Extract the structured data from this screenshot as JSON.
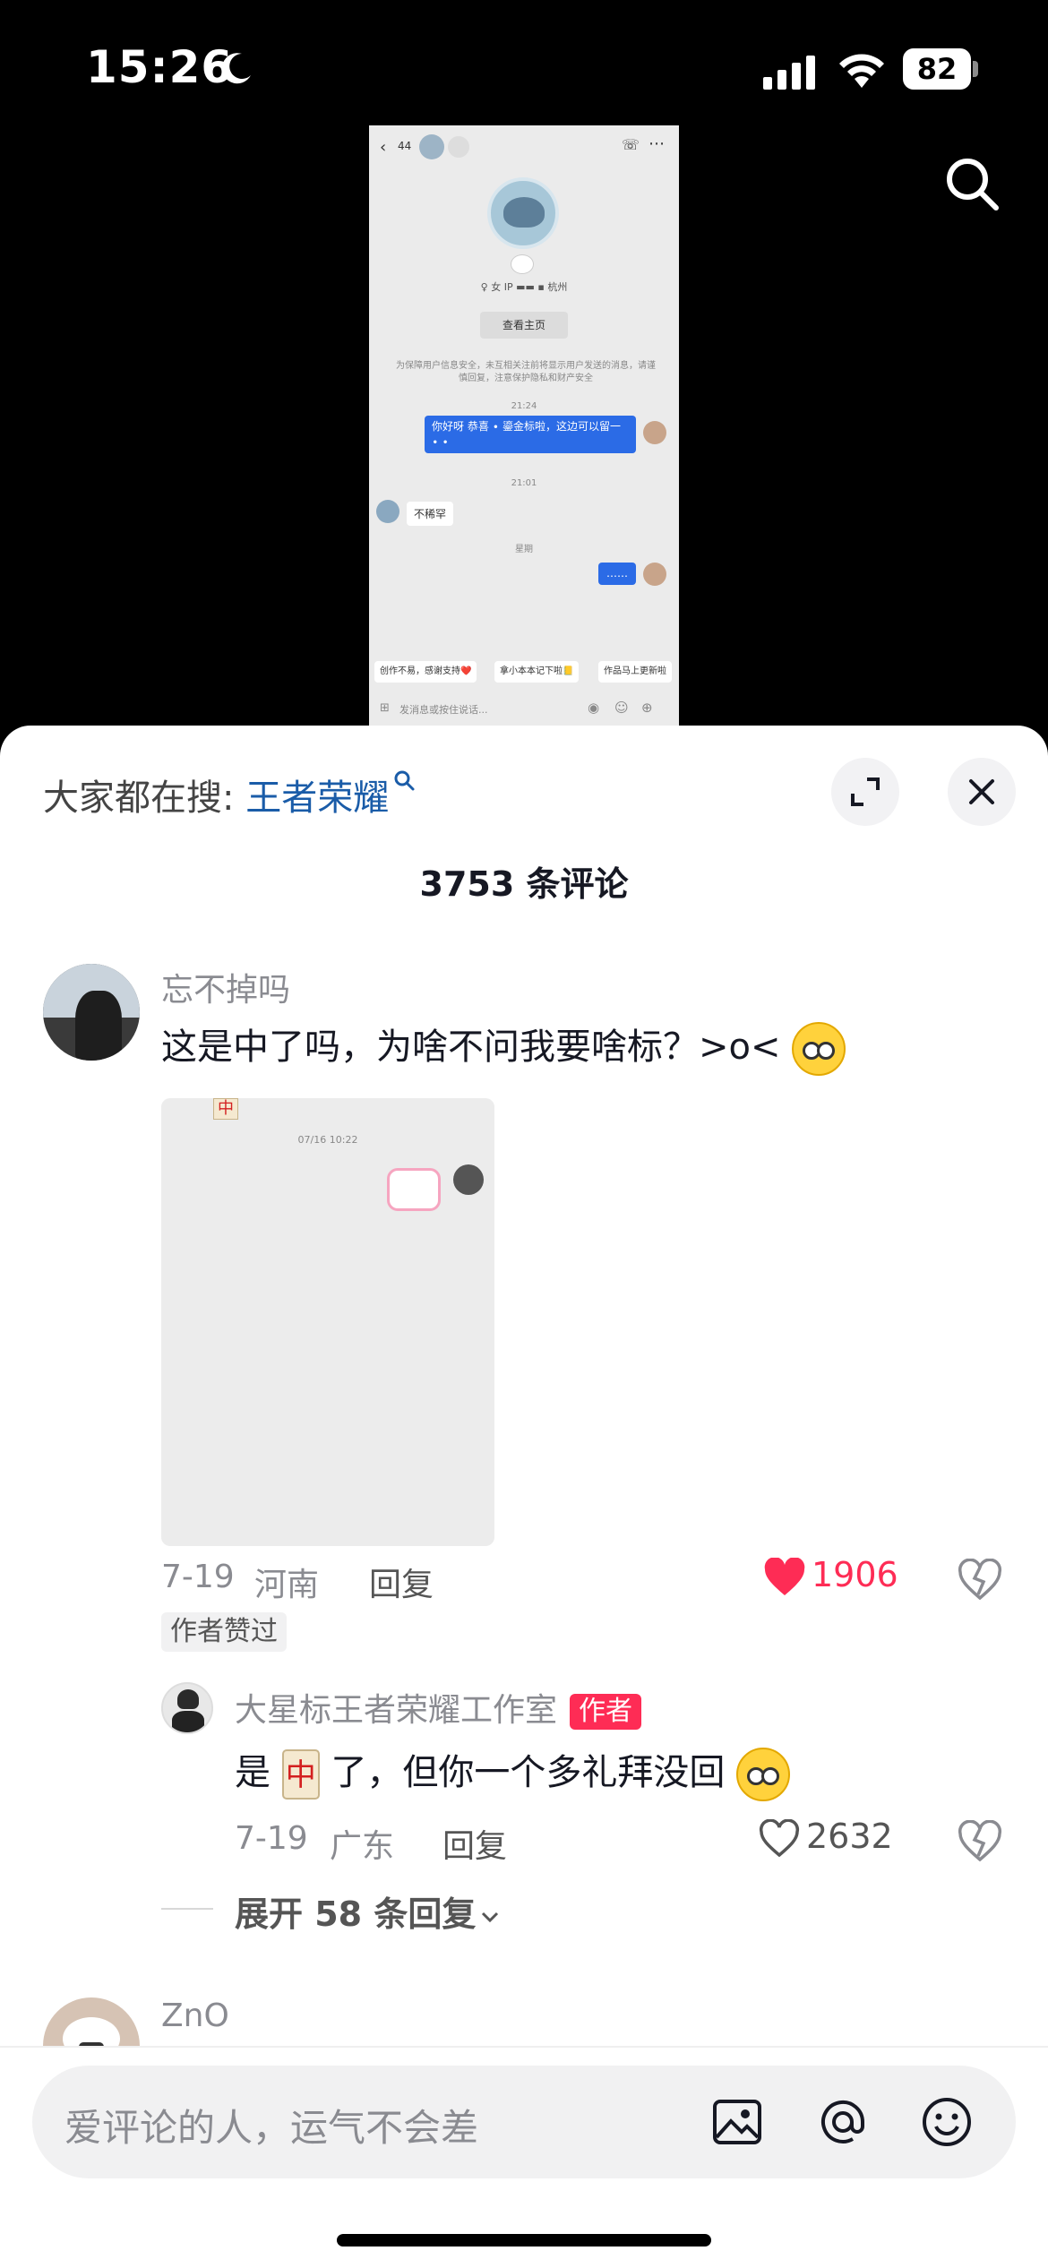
{
  "status_bar": {
    "time": "15:26",
    "battery": "82"
  },
  "video": {
    "back_count": "44",
    "tags": "♀ 女  IP ▬▬  ▪  杭州",
    "view_profile_button": "查看主页",
    "notice": "为保障用户信息安全，未互相关注前将显示用户发送的消息，请谨慎回复，注意保护隐私和财产安全",
    "time1": "21:24",
    "msg1": "你好呀 恭喜 ∙ 鎏金标啦，这边可以留一 ∙ ∙",
    "time2": "21:01",
    "msg2": "不稀罕",
    "time3": "星期",
    "msg3": "……",
    "quick1": "创作不易，感谢支持❤️",
    "quick2": "拿小本本记下啦📒",
    "quick3": "作品马上更新啦",
    "input_placeholder": "发消息或按住说话..."
  },
  "sheet": {
    "hot_search_prefix": "大家都在搜: ",
    "hot_search_keyword": "王者荣耀",
    "comment_count": "3753 条评论"
  },
  "comments": [
    {
      "username": "忘不掉吗",
      "text": "这是中了吗，为啥不问我要啥标？>o<",
      "image_time": "07/16 10:22",
      "date": "7-19",
      "location": "河南",
      "reply_label": "回复",
      "likes": "1906",
      "badge": "作者赞过",
      "reply": {
        "username": "大星标王者荣耀工作室",
        "tag": "作者",
        "text_before": "是",
        "text_after": "了，但你一个多礼拜没回",
        "date": "7-19",
        "location": "广东",
        "reply_label": "回复",
        "likes": "2632"
      },
      "expand_label": "展开 58 条回复"
    },
    {
      "username": "ZnO"
    }
  ],
  "bottom": {
    "placeholder": "爱评论的人，运气不会差"
  },
  "colors": {
    "like_red": "#fe2c55",
    "keyword_blue": "#1a5ca8",
    "chat_blue": "#2b6be6"
  }
}
